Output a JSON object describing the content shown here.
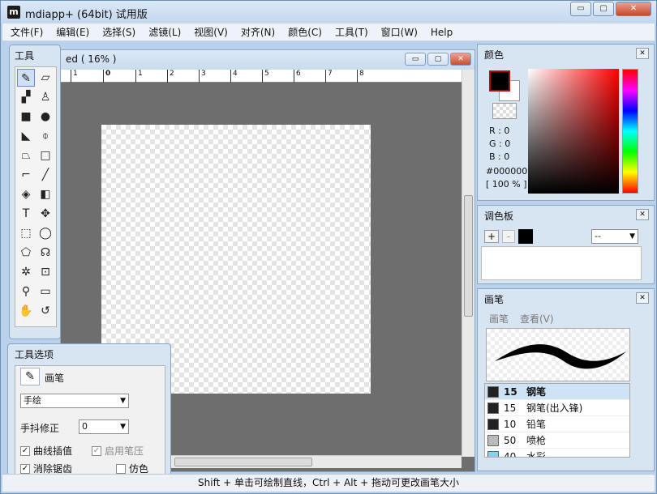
{
  "app": {
    "title": "mdiapp+ (64bit) 试用版",
    "icon": "m"
  },
  "window_buttons": {
    "minimize": "▭",
    "restore": "▢",
    "close": "✕"
  },
  "menu": [
    "文件(F)",
    "编辑(E)",
    "选择(S)",
    "滤镜(L)",
    "视图(V)",
    "对齐(N)",
    "颜色(C)",
    "工具(T)",
    "窗口(W)",
    "Help"
  ],
  "document": {
    "title": "ed ( 16% )",
    "ruler_marks": [
      "1",
      "0",
      "1",
      "2",
      "3",
      "4",
      "5",
      "6",
      "7",
      "8"
    ]
  },
  "tools_panel": {
    "title": "工具"
  },
  "tool_options": {
    "title": "工具选项",
    "tool_name": "画笔",
    "mode": "手绘",
    "stabilizer_label": "手抖修正",
    "stabilizer_value": "0",
    "curve_interp": "曲线插值",
    "enable_pressure": "启用笔压",
    "antialias": "消除锯齿",
    "imitate": "仿色"
  },
  "color_panel": {
    "title": "颜色",
    "r": "R : 0",
    "g": "G : 0",
    "b": "B : 0",
    "hex": "#000000",
    "opacity": "[ 100 % ]"
  },
  "palette_panel": {
    "title": "调色板",
    "add": "+",
    "remove": "-",
    "dropdown": "--"
  },
  "brush_panel": {
    "title": "画笔",
    "tab1": "画笔",
    "tab2": "查看(V)",
    "brushes": [
      {
        "size": "15",
        "name": "钢笔",
        "color": "#222222"
      },
      {
        "size": "15",
        "name": "钢笔(出入锋)",
        "color": "#222222"
      },
      {
        "size": "10",
        "name": "铅笔",
        "color": "#222222"
      },
      {
        "size": "50",
        "name": "喷枪",
        "color": "#bbbbbb"
      },
      {
        "size": "40",
        "name": "水彩",
        "color": "#7fd7f0"
      }
    ]
  },
  "status": "Shift + 单击可绘制直线，Ctrl + Alt + 拖动可更改画笔大小"
}
